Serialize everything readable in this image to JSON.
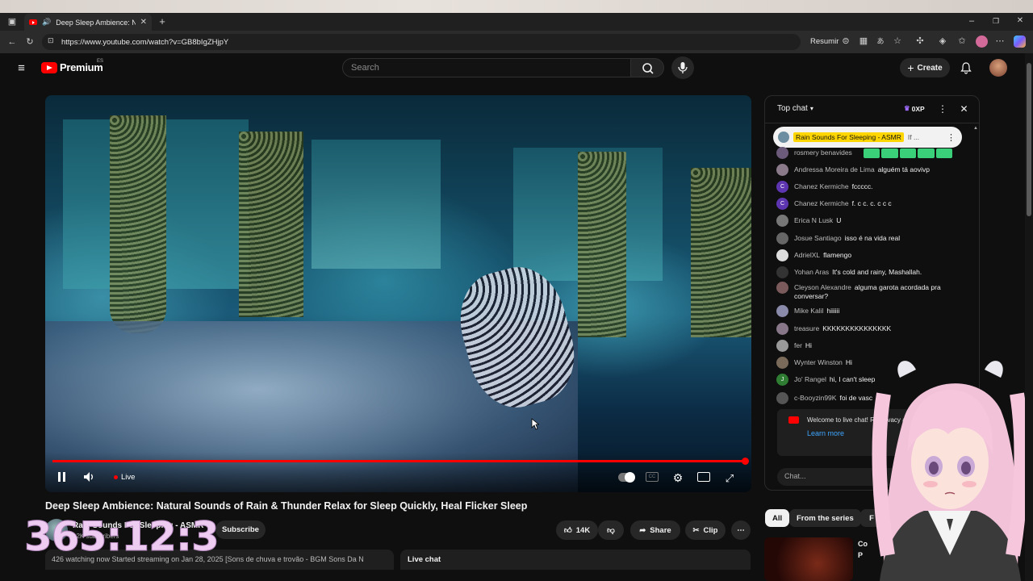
{
  "browser": {
    "tab_title": "Deep Sleep Ambience: Natural Sounds of Rain",
    "url": "https://www.youtube.com/watch?v=GB8bIgZHjpY",
    "resumir_label": "Resumir"
  },
  "youtube": {
    "brand": "Premium",
    "region": "ES",
    "search_placeholder": "Search",
    "create_label": "Create"
  },
  "player": {
    "live_label": "Live",
    "progress": 1.0,
    "accent": "#ff0000"
  },
  "video": {
    "title": "Deep Sleep Ambience: Natural Sounds of Rain & Thunder Relax for Sleep Quickly, Heal Flicker Sleep",
    "channel": "Rain Sounds For Sleeping - ASMR",
    "subscribers": "12K subscribers",
    "subscribe_label": "Subscribe",
    "likes": "14K",
    "share_label": "Share",
    "clip_label": "Clip",
    "description": "426 watching now  Started streaming on Jan 28, 2025   [Sons de chuva e trovão - BGM Sons Da N",
    "live_chat_label": "Live chat"
  },
  "overlay_counter": "365:12:3",
  "chat": {
    "header": "Top chat",
    "xp": "0XP",
    "pinned_author": "Rain Sounds For Sleeping - ASMR",
    "pinned_text": "If ...",
    "messages": [
      {
        "author": "rosmery benavides",
        "text": "",
        "avatar_color": "#6b5a7a",
        "initial": ""
      },
      {
        "author": "Andressa Moreira de Lima",
        "text": "alguém tá aovivp",
        "avatar_color": "#8a7a8a",
        "initial": ""
      },
      {
        "author": "Chanez Kermiche",
        "text": "fccccc.",
        "avatar_color": "#5e35b1",
        "initial": "C"
      },
      {
        "author": "Chanez Kermiche",
        "text": "f. c c. c. c c c",
        "avatar_color": "#5e35b1",
        "initial": "C"
      },
      {
        "author": "Erica N Lusk",
        "text": "U",
        "avatar_color": "#777777",
        "initial": ""
      },
      {
        "author": "Josue Santiago",
        "text": "isso é na vida real",
        "avatar_color": "#666666",
        "initial": ""
      },
      {
        "author": "AdrielXL",
        "text": "flamengo",
        "avatar_color": "#dddddd",
        "initial": ""
      },
      {
        "author": "Yohan Aras",
        "text": "It's cold and rainy, Mashallah.",
        "avatar_color": "#333333",
        "initial": ""
      },
      {
        "author": "Cleyson Alexandre",
        "text": "alguma garota acordada pra conversar?",
        "avatar_color": "#7a5a5a",
        "initial": ""
      },
      {
        "author": "Mike Kalil",
        "text": "hiiiiii",
        "avatar_color": "#8a8aaa",
        "initial": ""
      },
      {
        "author": "treasure",
        "text": "KKKKKKKKKKKKKKK",
        "avatar_color": "#887788",
        "initial": ""
      },
      {
        "author": "fer",
        "text": "Hi",
        "avatar_color": "#999999",
        "initial": ""
      },
      {
        "author": "Wynter Winston",
        "text": "Hi",
        "avatar_color": "#7a6a5a",
        "initial": ""
      },
      {
        "author": "Jo' Rangel",
        "text": "hi, I can't sleep",
        "avatar_color": "#2e7d32",
        "initial": "J"
      },
      {
        "author": "c-Booyzin99K",
        "text": "foi de vasc",
        "avatar_color": "#555555",
        "initial": ""
      }
    ],
    "welcome_text": "Welcome to live chat! Re privacy and abide by our",
    "learn_more": "Learn more",
    "input_placeholder": "Chat..."
  },
  "chips": {
    "all": "All",
    "series": "From the series",
    "more": "F"
  },
  "recommended": {
    "title_fragment": "Co P"
  }
}
